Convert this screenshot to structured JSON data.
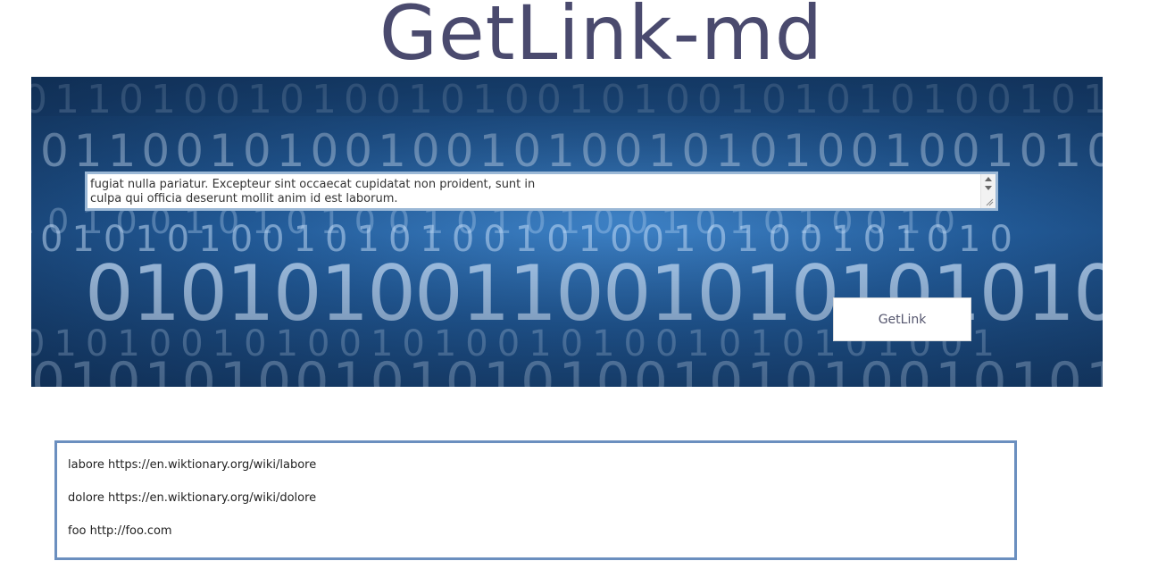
{
  "app": {
    "title": "GetLink-md"
  },
  "input": {
    "value": "fugiat nulla pariatur. Excepteur sint occaecat cupidatat non proident, sunt in\nculpa qui officia deserunt mollit anim id est laborum."
  },
  "actions": {
    "getlink_label": "GetLink"
  },
  "results": [
    "labore https://en.wiktionary.org/wiki/labore",
    "dolore https://en.wiktionary.org/wiki/dolore",
    "foo http://foo.com"
  ],
  "colors": {
    "title": "#4a4a6e",
    "hero_background": "#225a97",
    "results_border": "#6b8fbf"
  },
  "icons": {
    "hero": "binary-code-background",
    "scroll_up": "chevron-up-icon",
    "scroll_down": "chevron-down-icon",
    "resize": "resize-grip-icon"
  }
}
